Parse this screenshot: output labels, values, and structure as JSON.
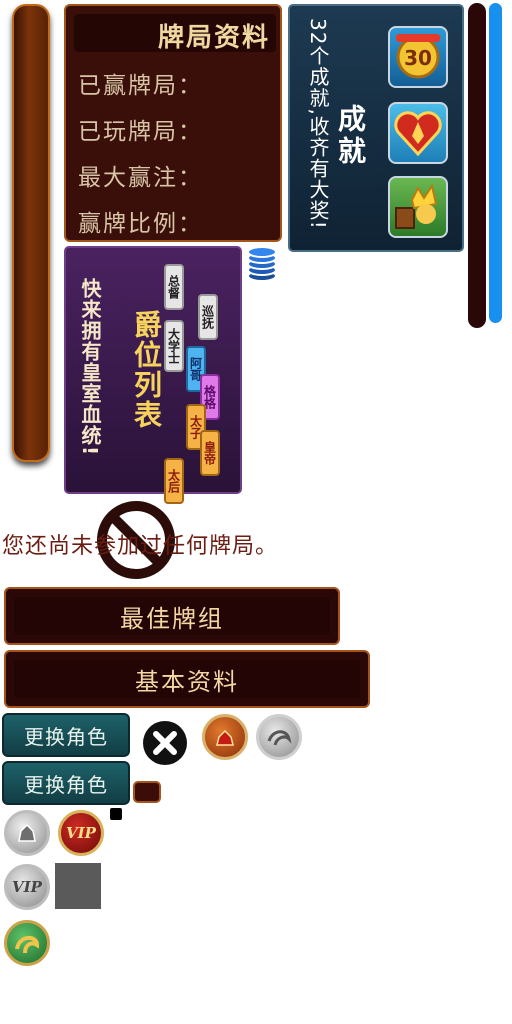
{
  "stats_panel": {
    "title": "牌局资料",
    "labels": [
      "已赢牌局：",
      "已玩牌局：",
      "最大赢注：",
      "赢牌比例："
    ]
  },
  "achievements": {
    "title": "成就",
    "description": "32个成就,收齐有大奖!",
    "badge_number": "30",
    "icons": [
      "trophy-30-icon",
      "heart-shield-icon",
      "crown-chest-icon"
    ]
  },
  "ranks": {
    "title": "爵位列表",
    "description": "快来拥有皇室血统!",
    "items": [
      {
        "label": "总督",
        "color": "#e6e6e6"
      },
      {
        "label": "巡抚",
        "color": "#e6e6e6"
      },
      {
        "label": "大学士",
        "color": "#e6e6e6"
      },
      {
        "label": "阿哥",
        "color": "#4fb3f0"
      },
      {
        "label": "格格",
        "color": "#e07ae8"
      },
      {
        "label": "太子",
        "color": "#f5b246"
      },
      {
        "label": "皇帝",
        "color": "#f5b246"
      },
      {
        "label": "太后",
        "color": "#f5b246"
      }
    ]
  },
  "empty_message": "您还尚未参加过任何牌局。",
  "buttons": {
    "best_hand": "最佳牌组",
    "basic_info": "基本资料",
    "change_role_1": "更换角色",
    "change_role_2": "更换角色"
  },
  "vip": {
    "gold_label": "VIP",
    "silver_label": "VIP"
  }
}
